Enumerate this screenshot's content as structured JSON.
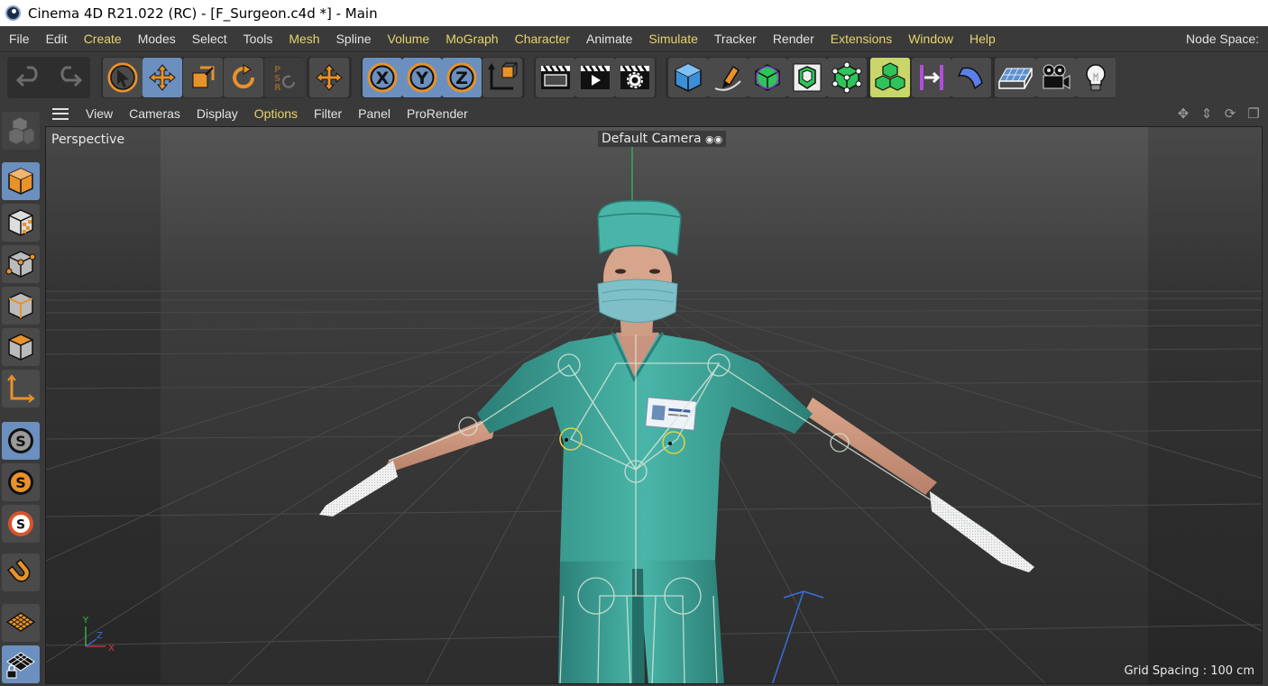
{
  "window": {
    "title": "Cinema 4D R21.022 (RC) - [F_Surgeon.c4d *] - Main",
    "app_icon": "cinema4d-logo-icon"
  },
  "menubar": {
    "items": [
      {
        "label": "File",
        "highlight": false
      },
      {
        "label": "Edit",
        "highlight": false
      },
      {
        "label": "Create",
        "highlight": true
      },
      {
        "label": "Modes",
        "highlight": false
      },
      {
        "label": "Select",
        "highlight": false
      },
      {
        "label": "Tools",
        "highlight": false
      },
      {
        "label": "Mesh",
        "highlight": true
      },
      {
        "label": "Spline",
        "highlight": false
      },
      {
        "label": "Volume",
        "highlight": true
      },
      {
        "label": "MoGraph",
        "highlight": true
      },
      {
        "label": "Character",
        "highlight": true
      },
      {
        "label": "Animate",
        "highlight": false
      },
      {
        "label": "Simulate",
        "highlight": true
      },
      {
        "label": "Tracker",
        "highlight": false
      },
      {
        "label": "Render",
        "highlight": false
      },
      {
        "label": "Extensions",
        "highlight": true
      },
      {
        "label": "Window",
        "highlight": true
      },
      {
        "label": "Help",
        "highlight": true
      }
    ],
    "node_space_label": "Node Space:",
    "highlight_color": "#e7d36a"
  },
  "toolbar": {
    "icons": [
      "undo-icon",
      "redo-icon",
      "select-arrow-icon",
      "move-icon",
      "scale-icon",
      "rotate-icon",
      "psr-icon",
      "transform-icon",
      "x-axis-icon",
      "y-axis-icon",
      "z-axis-icon",
      "coordinate-system-icon",
      "render-view-icon",
      "render-picture-viewer-icon",
      "render-settings-icon",
      "cube-icon",
      "pen-icon",
      "subdivision-icon",
      "extrude-icon",
      "cloner-icon",
      "array-icon",
      "deformer-icon",
      "bend-icon",
      "floor-icon",
      "camera-icon",
      "light-icon"
    ],
    "axis_labels": {
      "x": "X",
      "y": "Y",
      "z": "Z"
    },
    "psr_letters": [
      "P",
      "S",
      "R"
    ]
  },
  "left_toolbar": {
    "icons": [
      "make-editable-icon",
      "model-mode-icon",
      "texture-mode-icon",
      "point-mode-icon",
      "edge-mode-icon",
      "polygon-mode-icon",
      "axis-mode-icon",
      "snap-icon",
      "snap-enabled-icon",
      "snap-settings-icon",
      "magnet-icon",
      "workplane-icon",
      "locked-workplane-icon"
    ],
    "snap_letter": "S"
  },
  "viewport_menu": {
    "items": [
      {
        "label": "View",
        "highlight": false
      },
      {
        "label": "Cameras",
        "highlight": false
      },
      {
        "label": "Display",
        "highlight": false
      },
      {
        "label": "Options",
        "highlight": true
      },
      {
        "label": "Filter",
        "highlight": false
      },
      {
        "label": "Panel",
        "highlight": false
      },
      {
        "label": "ProRender",
        "highlight": false
      }
    ],
    "nav_icons": [
      "pan-icon",
      "dolly-icon",
      "orbit-icon",
      "maximize-icon"
    ]
  },
  "viewport": {
    "view_name": "Perspective",
    "camera_name": "Default Camera",
    "grid_spacing": "Grid Spacing : 100 cm",
    "axis_labels": {
      "x": "X",
      "y": "Y",
      "z": "Z"
    },
    "model": "female-surgeon-character",
    "scrubs_color": "#3fa89c"
  }
}
